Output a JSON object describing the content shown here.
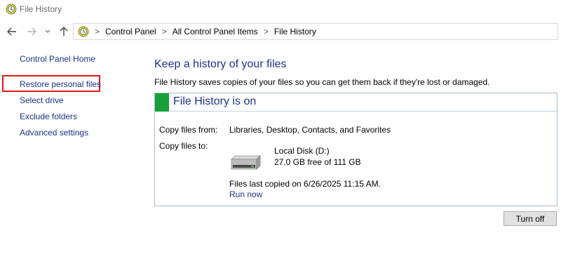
{
  "window": {
    "title": "File History",
    "title_icon": "file-history-icon"
  },
  "navigation": {
    "back_icon": "arrow-left-icon",
    "forward_icon": "arrow-right-icon",
    "recent_icon": "chevron-down-icon",
    "up_icon": "arrow-up-icon",
    "breadcrumb": [
      {
        "label": "Control Panel"
      },
      {
        "label": "All Control Panel Items"
      },
      {
        "label": "File History"
      }
    ],
    "separator": ">"
  },
  "sidebar": {
    "items": [
      {
        "label": "Control Panel Home"
      },
      {
        "label": "Restore personal files",
        "highlighted": true
      },
      {
        "label": "Select drive"
      },
      {
        "label": "Exclude folders"
      },
      {
        "label": "Advanced settings"
      }
    ]
  },
  "main": {
    "heading": "Keep a history of your files",
    "description": "File History saves copies of your files so you can get them back if they're lost or damaged.",
    "status": {
      "text": "File History is on",
      "color": "#17a03b"
    },
    "copy_from": {
      "label": "Copy files from:",
      "value": "Libraries, Desktop, Contacts, and Favorites"
    },
    "copy_to": {
      "label": "Copy files to:",
      "drive_name": "Local Disk (D:)",
      "drive_space": "27.0 GB free of 111 GB",
      "drive_icon": "hard-drive-icon"
    },
    "last_copied": "Files last copied on 6/26/2025 11:15 AM.",
    "run_now_label": "Run now",
    "turn_off_label": "Turn off"
  },
  "colors": {
    "link": "#1e3287",
    "highlight_box": "#e0191c",
    "status_on": "#17a03b",
    "panel_border": "#a9bcd0"
  }
}
